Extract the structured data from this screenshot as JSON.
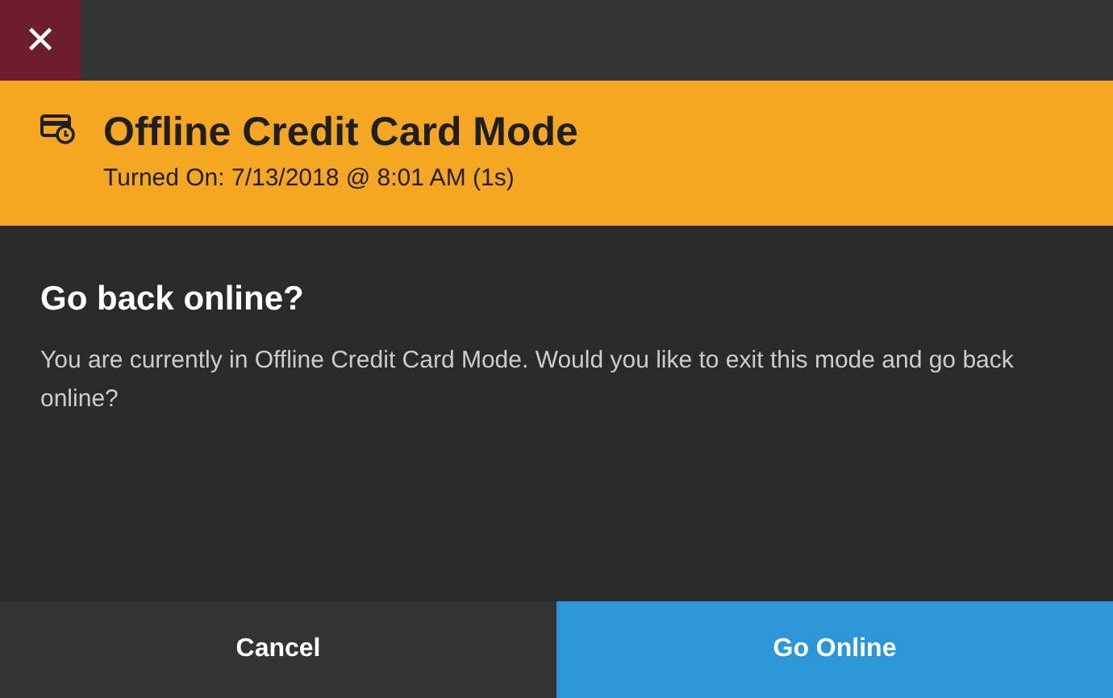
{
  "close_button": {
    "label": "✕"
  },
  "banner": {
    "title": "Offline Credit Card Mode",
    "subtitle": "Turned On: 7/13/2018 @ 8:01 AM (1s)"
  },
  "dialog": {
    "heading": "Go back online?",
    "message": "You are currently in Offline Credit Card Mode. Would you like to exit this mode and go back online?"
  },
  "buttons": [
    {
      "label": "Cancel",
      "kind": "secondary"
    },
    {
      "label": "Go Online",
      "kind": "primary"
    }
  ]
}
